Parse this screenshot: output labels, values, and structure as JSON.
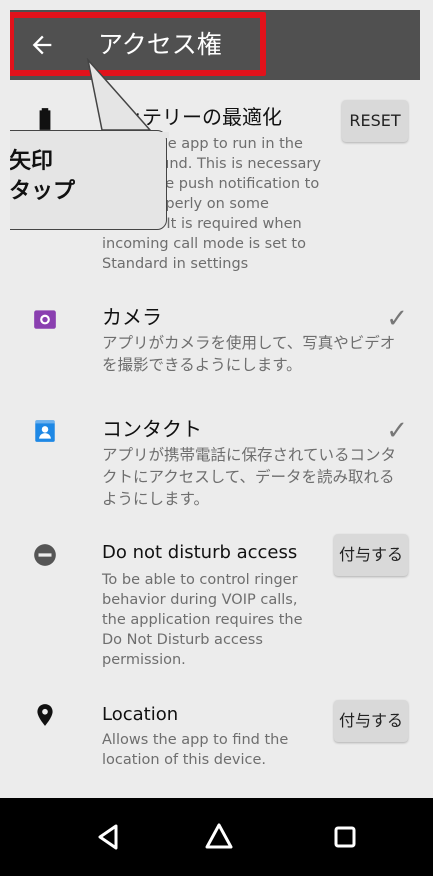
{
  "header": {
    "title": "アクセス権",
    "back_icon": "arrow-left-icon"
  },
  "callout": {
    "line1": "矢印",
    "line2": "タップ"
  },
  "items": [
    {
      "title": "バッテリーの最適化",
      "description": "Allows the app to run in the background. This is necessary to receive push notification to work properly on some devices. It is required when incoming call mode is set to Standard in settings",
      "action": "RESET",
      "icon": "battery-icon"
    },
    {
      "title": "カメラ",
      "description": "アプリがカメラを使用して、写真やビデオを撮影できるようにします。",
      "status": "✓",
      "icon": "camera-icon",
      "icon_color": "#8a3fb0"
    },
    {
      "title": "コンタクト",
      "description": "アプリが携帯電話に保存されているコンタクトにアクセスして、データを読み取れるようにします。",
      "status": "✓",
      "icon": "contact-icon",
      "icon_color": "#1e88e5"
    },
    {
      "title": "Do not disturb access",
      "description": "To be able to control ringer behavior during VOIP calls, the application requires the Do Not Disturb access permission.",
      "action": "付与する",
      "icon": "do-not-disturb-icon"
    },
    {
      "title": "Location",
      "description": "Allows the app to find the location of this device.",
      "action": "付与する",
      "icon": "location-pin-icon"
    }
  ],
  "navbar": {
    "back": "nav-back-icon",
    "home": "nav-home-icon",
    "recents": "nav-recents-icon"
  },
  "colors": {
    "appbar": "#505050",
    "highlight": "#e2121b",
    "background": "#ececec"
  }
}
